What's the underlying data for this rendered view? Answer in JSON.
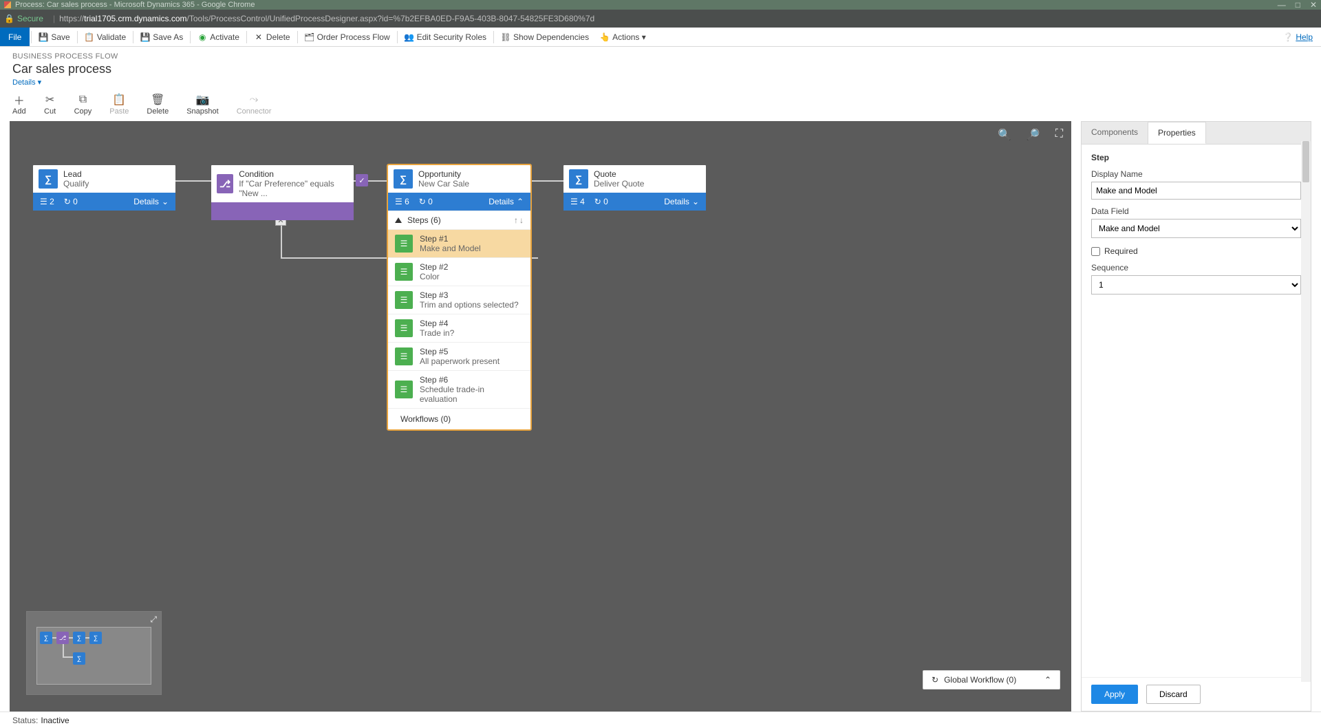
{
  "window": {
    "title": "Process: Car sales process - Microsoft Dynamics 365 - Google Chrome",
    "secure_label": "Secure",
    "url_prefix": "https://",
    "url_domain": "trial1705.crm.dynamics.com",
    "url_path": "/Tools/ProcessControl/UnifiedProcessDesigner.aspx?id=%7b2EFBA0ED-F9A5-403B-8047-54825FE3D680%7d"
  },
  "ribbon": {
    "file": "File",
    "save": "Save",
    "validate": "Validate",
    "save_as": "Save As",
    "activate": "Activate",
    "delete": "Delete",
    "order_pf": "Order Process Flow",
    "edit_roles": "Edit Security Roles",
    "show_dep": "Show Dependencies",
    "actions": "Actions ▾",
    "help": "Help"
  },
  "header": {
    "sup": "BUSINESS PROCESS FLOW",
    "title": "Car sales process",
    "details": "Details ▾"
  },
  "toolbar": {
    "add": "Add",
    "cut": "Cut",
    "copy": "Copy",
    "paste": "Paste",
    "delete": "Delete",
    "snapshot": "Snapshot",
    "connector": "Connector"
  },
  "nodes": {
    "lead": {
      "title": "Lead",
      "sub": "Qualify",
      "steps": "2",
      "wf": "0",
      "details": "Details"
    },
    "condition": {
      "title": "Condition",
      "sub": "If \"Car Preference\" equals \"New ..."
    },
    "opportunity": {
      "title": "Opportunity",
      "sub": "New Car Sale",
      "steps": "6",
      "wf": "0",
      "details": "Details"
    },
    "quote": {
      "title": "Quote",
      "sub": "Deliver Quote",
      "steps": "4",
      "wf": "0",
      "details": "Details"
    }
  },
  "steps_header": "Steps (6)",
  "steps": [
    {
      "num": "Step #1",
      "label": "Make and Model"
    },
    {
      "num": "Step #2",
      "label": "Color"
    },
    {
      "num": "Step #3",
      "label": "Trim and options selected?"
    },
    {
      "num": "Step #4",
      "label": "Trade in?"
    },
    {
      "num": "Step #5",
      "label": "All paperwork present"
    },
    {
      "num": "Step #6",
      "label": "Schedule trade-in evaluation"
    }
  ],
  "workflows_header": "Workflows (0)",
  "global_workflow": "Global Workflow (0)",
  "panel": {
    "tab_components": "Components",
    "tab_properties": "Properties",
    "section": "Step",
    "display_name_label": "Display Name",
    "display_name_value": "Make and Model",
    "data_field_label": "Data Field",
    "data_field_value": "Make and Model",
    "required_label": "Required",
    "sequence_label": "Sequence",
    "sequence_value": "1",
    "apply": "Apply",
    "discard": "Discard"
  },
  "status": {
    "label": "Status:",
    "value": "Inactive"
  }
}
